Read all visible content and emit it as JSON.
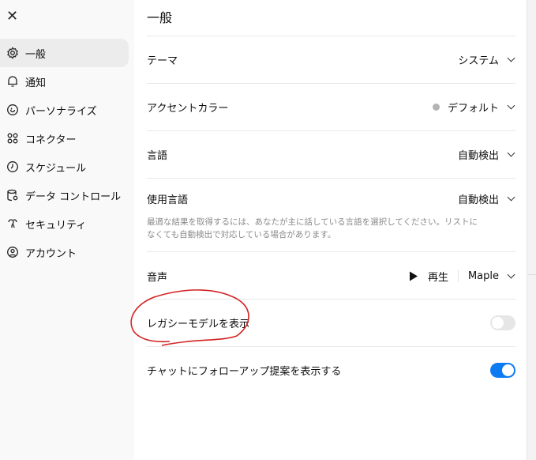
{
  "sidebar": {
    "close_label": "✕",
    "items": [
      {
        "label": "一般",
        "icon": "gear-icon"
      },
      {
        "label": "通知",
        "icon": "bell-icon"
      },
      {
        "label": "パーソナライズ",
        "icon": "personalize-icon"
      },
      {
        "label": "コネクター",
        "icon": "connector-icon"
      },
      {
        "label": "スケジュール",
        "icon": "clock-icon"
      },
      {
        "label": "データ コントロール",
        "icon": "database-icon"
      },
      {
        "label": "セキュリティ",
        "icon": "key-icon"
      },
      {
        "label": "アカウント",
        "icon": "account-icon"
      }
    ]
  },
  "main": {
    "title": "一般",
    "theme": {
      "label": "テーマ",
      "value": "システム"
    },
    "accent": {
      "label": "アクセントカラー",
      "value": "デフォルト",
      "color": "#b4b4b4"
    },
    "language": {
      "label": "言語",
      "value": "自動検出"
    },
    "spoken": {
      "label": "使用言語",
      "value": "自動検出",
      "description": "最適な結果を取得するには、あなたが主に話している言語を選択してください。リストになくても自動検出で対応している場合があります。"
    },
    "voice": {
      "label": "音声",
      "play": "再生",
      "value": "Maple"
    },
    "legacy": {
      "label": "レガシーモデルを表示",
      "enabled": false
    },
    "followup": {
      "label": "チャットにフォローアップ提案を表示する",
      "enabled": true
    }
  },
  "colors": {
    "toggle_on": "#0d7cf2",
    "annotation": "#d42020"
  }
}
